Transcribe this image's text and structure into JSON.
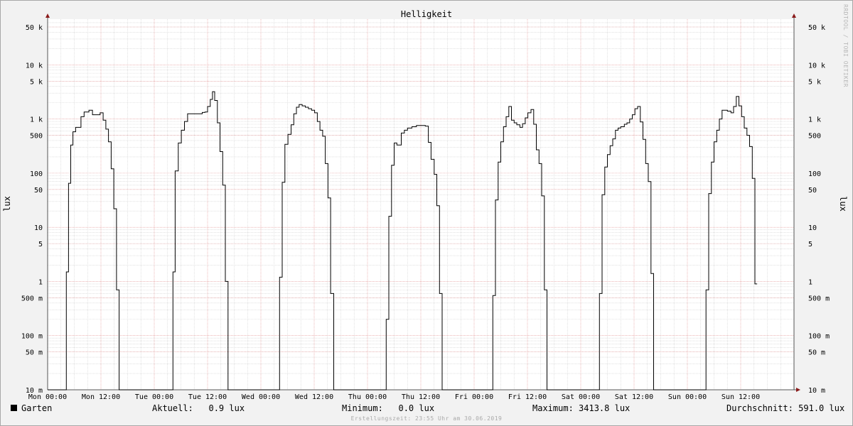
{
  "chart_data": {
    "type": "line",
    "title": "Helligkeit",
    "ylabel": "lux",
    "ylabel_right": "lux",
    "yscale": "log",
    "ylim": [
      0.01,
      80000
    ],
    "xlim": [
      0,
      168
    ],
    "x_units": "hours since Mon 00:00",
    "grid": true,
    "y_ticks": [
      {
        "value": 50000,
        "label": "50 k"
      },
      {
        "value": 10000,
        "label": "10 k"
      },
      {
        "value": 5000,
        "label": "5 k"
      },
      {
        "value": 1000,
        "label": "1 k"
      },
      {
        "value": 500,
        "label": "500"
      },
      {
        "value": 100,
        "label": "100"
      },
      {
        "value": 50,
        "label": "50"
      },
      {
        "value": 10,
        "label": "10"
      },
      {
        "value": 5,
        "label": "5"
      },
      {
        "value": 1,
        "label": "1"
      },
      {
        "value": 0.5,
        "label": "500 m"
      },
      {
        "value": 0.1,
        "label": "100 m"
      },
      {
        "value": 0.05,
        "label": "50 m"
      },
      {
        "value": 0.01,
        "label": "10 m"
      }
    ],
    "x_ticks": [
      {
        "value": 0,
        "label": "Mon 00:00"
      },
      {
        "value": 12,
        "label": "Mon 12:00"
      },
      {
        "value": 24,
        "label": "Tue 00:00"
      },
      {
        "value": 36,
        "label": "Tue 12:00"
      },
      {
        "value": 48,
        "label": "Wed 00:00"
      },
      {
        "value": 60,
        "label": "Wed 12:00"
      },
      {
        "value": 72,
        "label": "Thu 00:00"
      },
      {
        "value": 84,
        "label": "Thu 12:00"
      },
      {
        "value": 96,
        "label": "Fri 00:00"
      },
      {
        "value": 108,
        "label": "Fri 12:00"
      },
      {
        "value": 120,
        "label": "Sat 00:00"
      },
      {
        "value": 132,
        "label": "Sat 12:00"
      },
      {
        "value": 144,
        "label": "Sun 00:00"
      },
      {
        "value": 156,
        "label": "Sun 12:00"
      }
    ],
    "series": [
      {
        "name": "Garten",
        "color": "#000000",
        "points": [
          [
            0,
            0.01
          ],
          [
            4.2,
            0.01
          ],
          [
            4.2,
            1.5
          ],
          [
            4.7,
            1.5
          ],
          [
            4.7,
            65
          ],
          [
            5.2,
            65
          ],
          [
            5.2,
            330
          ],
          [
            5.7,
            330
          ],
          [
            5.7,
            580
          ],
          [
            6.3,
            580
          ],
          [
            6.3,
            700
          ],
          [
            7.5,
            700
          ],
          [
            7.5,
            1100
          ],
          [
            8.2,
            1100
          ],
          [
            8.2,
            1350
          ],
          [
            9.3,
            1350
          ],
          [
            9.3,
            1450
          ],
          [
            10.1,
            1450
          ],
          [
            10.1,
            1200
          ],
          [
            11.8,
            1200
          ],
          [
            11.8,
            1300
          ],
          [
            12.5,
            1300
          ],
          [
            12.5,
            950
          ],
          [
            13.1,
            950
          ],
          [
            13.1,
            650
          ],
          [
            13.7,
            650
          ],
          [
            13.7,
            380
          ],
          [
            14.3,
            380
          ],
          [
            14.3,
            120
          ],
          [
            14.9,
            120
          ],
          [
            14.9,
            22
          ],
          [
            15.5,
            22
          ],
          [
            15.5,
            0.7
          ],
          [
            16.1,
            0.7
          ],
          [
            16.1,
            0.01
          ],
          [
            28.2,
            0.01
          ],
          [
            28.2,
            1.5
          ],
          [
            28.7,
            1.5
          ],
          [
            28.7,
            110
          ],
          [
            29.4,
            110
          ],
          [
            29.4,
            360
          ],
          [
            30.1,
            360
          ],
          [
            30.1,
            620
          ],
          [
            30.8,
            620
          ],
          [
            30.8,
            900
          ],
          [
            31.5,
            900
          ],
          [
            31.5,
            1250
          ],
          [
            34.8,
            1250
          ],
          [
            34.8,
            1320
          ],
          [
            35.4,
            1320
          ],
          [
            35.4,
            1350
          ],
          [
            36.0,
            1350
          ],
          [
            36.0,
            1700
          ],
          [
            36.6,
            1700
          ],
          [
            36.6,
            2300
          ],
          [
            37.1,
            2300
          ],
          [
            37.1,
            3200
          ],
          [
            37.6,
            3200
          ],
          [
            37.6,
            2200
          ],
          [
            38.2,
            2200
          ],
          [
            38.2,
            850
          ],
          [
            38.8,
            850
          ],
          [
            38.8,
            250
          ],
          [
            39.4,
            250
          ],
          [
            39.4,
            60
          ],
          [
            40.0,
            60
          ],
          [
            40.0,
            1
          ],
          [
            40.6,
            1
          ],
          [
            40.6,
            0.01
          ],
          [
            52.2,
            0.01
          ],
          [
            52.2,
            1.2
          ],
          [
            52.8,
            1.2
          ],
          [
            52.8,
            68
          ],
          [
            53.4,
            68
          ],
          [
            53.4,
            340
          ],
          [
            54.1,
            340
          ],
          [
            54.1,
            520
          ],
          [
            54.8,
            520
          ],
          [
            54.8,
            780
          ],
          [
            55.4,
            780
          ],
          [
            55.4,
            1250
          ],
          [
            56.0,
            1250
          ],
          [
            56.0,
            1650
          ],
          [
            56.6,
            1650
          ],
          [
            56.6,
            1850
          ],
          [
            57.3,
            1850
          ],
          [
            57.3,
            1750
          ],
          [
            58.0,
            1750
          ],
          [
            58.0,
            1650
          ],
          [
            58.7,
            1650
          ],
          [
            58.7,
            1550
          ],
          [
            59.4,
            1550
          ],
          [
            59.4,
            1450
          ],
          [
            60.1,
            1450
          ],
          [
            60.1,
            1300
          ],
          [
            60.7,
            1300
          ],
          [
            60.7,
            900
          ],
          [
            61.3,
            900
          ],
          [
            61.3,
            620
          ],
          [
            61.9,
            620
          ],
          [
            61.9,
            480
          ],
          [
            62.5,
            480
          ],
          [
            62.5,
            150
          ],
          [
            63.1,
            150
          ],
          [
            63.1,
            35
          ],
          [
            63.7,
            35
          ],
          [
            63.7,
            0.6
          ],
          [
            64.4,
            0.6
          ],
          [
            64.4,
            0.01
          ],
          [
            76.2,
            0.01
          ],
          [
            76.2,
            0.2
          ],
          [
            76.8,
            0.2
          ],
          [
            76.8,
            16
          ],
          [
            77.4,
            16
          ],
          [
            77.4,
            140
          ],
          [
            78.0,
            140
          ],
          [
            78.0,
            360
          ],
          [
            78.6,
            360
          ],
          [
            78.6,
            330
          ],
          [
            79.6,
            330
          ],
          [
            79.6,
            550
          ],
          [
            80.3,
            550
          ],
          [
            80.3,
            620
          ],
          [
            81.0,
            620
          ],
          [
            81.0,
            680
          ],
          [
            82.0,
            680
          ],
          [
            82.0,
            720
          ],
          [
            83.0,
            720
          ],
          [
            83.0,
            760
          ],
          [
            85.0,
            760
          ],
          [
            85.0,
            740
          ],
          [
            85.7,
            740
          ],
          [
            85.7,
            370
          ],
          [
            86.3,
            370
          ],
          [
            86.3,
            180
          ],
          [
            87.0,
            180
          ],
          [
            87.0,
            95
          ],
          [
            87.6,
            95
          ],
          [
            87.6,
            25
          ],
          [
            88.2,
            25
          ],
          [
            88.2,
            0.6
          ],
          [
            88.8,
            0.6
          ],
          [
            88.8,
            0.01
          ],
          [
            100.2,
            0.01
          ],
          [
            100.2,
            0.55
          ],
          [
            100.8,
            0.55
          ],
          [
            100.8,
            32
          ],
          [
            101.4,
            32
          ],
          [
            101.4,
            160
          ],
          [
            102.0,
            160
          ],
          [
            102.0,
            380
          ],
          [
            102.6,
            380
          ],
          [
            102.6,
            720
          ],
          [
            103.2,
            720
          ],
          [
            103.2,
            1100
          ],
          [
            103.8,
            1100
          ],
          [
            103.8,
            1700
          ],
          [
            104.4,
            1700
          ],
          [
            104.4,
            950
          ],
          [
            105.0,
            950
          ],
          [
            105.0,
            850
          ],
          [
            105.6,
            850
          ],
          [
            105.6,
            780
          ],
          [
            106.3,
            780
          ],
          [
            106.3,
            700
          ],
          [
            106.9,
            700
          ],
          [
            106.9,
            820
          ],
          [
            107.5,
            820
          ],
          [
            107.5,
            1050
          ],
          [
            108.1,
            1050
          ],
          [
            108.1,
            1300
          ],
          [
            108.8,
            1300
          ],
          [
            108.8,
            1500
          ],
          [
            109.4,
            1500
          ],
          [
            109.4,
            800
          ],
          [
            110.0,
            800
          ],
          [
            110.0,
            270
          ],
          [
            110.6,
            270
          ],
          [
            110.6,
            150
          ],
          [
            111.2,
            150
          ],
          [
            111.2,
            38
          ],
          [
            111.8,
            38
          ],
          [
            111.8,
            0.7
          ],
          [
            112.4,
            0.7
          ],
          [
            112.4,
            0.01
          ],
          [
            124.2,
            0.01
          ],
          [
            124.2,
            0.6
          ],
          [
            124.8,
            0.6
          ],
          [
            124.8,
            40
          ],
          [
            125.4,
            40
          ],
          [
            125.4,
            130
          ],
          [
            126.0,
            130
          ],
          [
            126.0,
            220
          ],
          [
            126.6,
            220
          ],
          [
            126.6,
            320
          ],
          [
            127.2,
            320
          ],
          [
            127.2,
            430
          ],
          [
            127.8,
            430
          ],
          [
            127.8,
            620
          ],
          [
            128.4,
            620
          ],
          [
            128.4,
            680
          ],
          [
            129.0,
            680
          ],
          [
            129.0,
            720
          ],
          [
            129.8,
            720
          ],
          [
            129.8,
            800
          ],
          [
            130.4,
            800
          ],
          [
            130.4,
            850
          ],
          [
            131.0,
            850
          ],
          [
            131.0,
            1000
          ],
          [
            131.6,
            1000
          ],
          [
            131.6,
            1200
          ],
          [
            132.2,
            1200
          ],
          [
            132.2,
            1550
          ],
          [
            132.8,
            1550
          ],
          [
            132.8,
            1700
          ],
          [
            133.4,
            1700
          ],
          [
            133.4,
            880
          ],
          [
            134.0,
            880
          ],
          [
            134.0,
            420
          ],
          [
            134.6,
            420
          ],
          [
            134.6,
            150
          ],
          [
            135.2,
            150
          ],
          [
            135.2,
            70
          ],
          [
            135.8,
            70
          ],
          [
            135.8,
            1.4
          ],
          [
            136.4,
            1.4
          ],
          [
            136.4,
            0.01
          ],
          [
            148.2,
            0.01
          ],
          [
            148.2,
            0.7
          ],
          [
            148.8,
            0.7
          ],
          [
            148.8,
            42
          ],
          [
            149.4,
            42
          ],
          [
            149.4,
            160
          ],
          [
            150.0,
            160
          ],
          [
            150.0,
            380
          ],
          [
            150.6,
            380
          ],
          [
            150.6,
            620
          ],
          [
            151.2,
            620
          ],
          [
            151.2,
            1000
          ],
          [
            151.8,
            1000
          ],
          [
            151.8,
            1450
          ],
          [
            153.0,
            1450
          ],
          [
            153.0,
            1400
          ],
          [
            153.8,
            1400
          ],
          [
            153.8,
            1300
          ],
          [
            154.4,
            1300
          ],
          [
            154.4,
            1700
          ],
          [
            155.0,
            1700
          ],
          [
            155.0,
            2600
          ],
          [
            155.6,
            2600
          ],
          [
            155.6,
            1750
          ],
          [
            156.2,
            1750
          ],
          [
            156.2,
            1100
          ],
          [
            156.8,
            1100
          ],
          [
            156.8,
            680
          ],
          [
            157.4,
            680
          ],
          [
            157.4,
            500
          ],
          [
            158.0,
            500
          ],
          [
            158.0,
            310
          ],
          [
            158.6,
            310
          ],
          [
            158.6,
            80
          ],
          [
            159.2,
            80
          ],
          [
            159.2,
            0.9
          ],
          [
            159.7,
            0.9
          ]
        ]
      }
    ]
  },
  "legend": {
    "series_name": "Garten",
    "aktuell": "Aktuell:   0.9 lux",
    "minimum": "Minimum:   0.0 lux",
    "maximum": "Maximum: 3413.8 lux",
    "durchschnitt": "Durchschnitt: 591.0 lux"
  },
  "footer": "Erstellungszeit: 23:55 Uhr am 30.06.2019",
  "watermark": "RRDTOOL / TOBI OETIKER",
  "colors": {
    "background": "#f2f2f2",
    "plot_background": "#ffffff",
    "major_grid": "#e08a8a",
    "minor_grid": "#cfcfcf",
    "axis_arrow": "#8b1a1a",
    "line": "#000000"
  }
}
